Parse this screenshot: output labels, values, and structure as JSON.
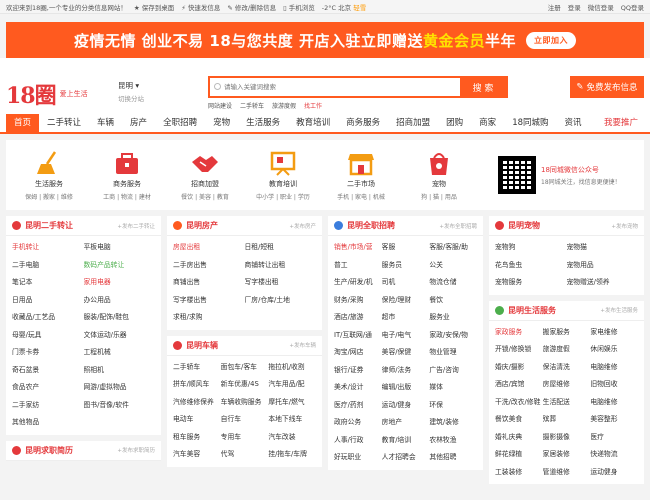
{
  "topbar": {
    "welcome": "欢迎来到18圈,一个专业的分类信息网站！",
    "links": [
      "保存到桌面",
      "快速发信息",
      "修改/删除信息",
      "手机浏览"
    ],
    "weather": "-2°C 北京",
    "weather_extra": "轻雪",
    "right": [
      "注册",
      "登录",
      "微信登录",
      "QQ登录"
    ]
  },
  "banner": {
    "text1": "疫情无情 创业不易 18与您共度 开店入驻立即赠送",
    "gold": "黄金会员",
    "text2": "半年",
    "button": "立即加入"
  },
  "header": {
    "logo_num": "18圈",
    "logo_tag": "爱上生活",
    "city": "昆明",
    "city_arrow": "·",
    "switch": "切换分站",
    "search_placeholder": "请输入关键词搜索",
    "search_button": "搜 索",
    "hot": [
      "网站建设",
      "二手轿车",
      "旅游度假",
      "找工作"
    ],
    "publish": "免费发布信息"
  },
  "nav": [
    "首页",
    "二手转让",
    "车辆",
    "房产",
    "全职招聘",
    "宠物",
    "生活服务",
    "教育培训",
    "商务服务",
    "招商加盟",
    "团购",
    "商家",
    "18同城购",
    "资讯",
    "我要推广"
  ],
  "categories": [
    {
      "name": "生活服务",
      "sub": "保姆 | 搬家 | 维修",
      "icon": "broom-icon"
    },
    {
      "name": "商务服务",
      "sub": "工商 | 物流 | 建材",
      "icon": "briefcase-icon"
    },
    {
      "name": "招商加盟",
      "sub": "餐饮 | 美容 | 教育",
      "icon": "handshake-icon"
    },
    {
      "name": "教育培训",
      "sub": "中小学 | 职业 | 学历",
      "icon": "blackboard-icon"
    },
    {
      "name": "二手市场",
      "sub": "手机 | 家电 | 机械",
      "icon": "shop-icon"
    },
    {
      "name": "宠物",
      "sub": "狗 | 猫 | 用品",
      "icon": "pet-bag-icon"
    }
  ],
  "qr": {
    "title": "18同城微信公众号",
    "desc": "18同城关注，找信息更便捷！"
  },
  "panels": {
    "used": {
      "title": "昆明二手转让",
      "link": "+发布二手转让",
      "items": [
        "手机转让",
        "平板电脑",
        "二手电脑",
        "数码产品转让",
        "笔记本",
        "家用电器",
        "日用品",
        "办公用品",
        "收藏品/工艺品",
        "服装/配饰/鞋包",
        "母婴/玩具",
        "文体运动/乐器",
        "门票卡券",
        "工程机械",
        "奇石盆景",
        "照相机",
        "食品农产",
        "网游/虚拟物品",
        "二手家纺",
        "图书/音像/软件",
        "其他物品",
        ""
      ]
    },
    "jobs2": {
      "title": "昆明求职简历",
      "link": "+发布求职简历"
    },
    "house": {
      "title": "昆明房产",
      "link": "+发布房产",
      "items": [
        "房屋出租",
        "日租/短租",
        "二手房出售",
        "商铺转让出租",
        "商铺出售",
        "写字楼出租",
        "写字楼出售",
        "厂房/仓库/土地",
        "求租/求购",
        ""
      ]
    },
    "cars": {
      "title": "昆明车辆",
      "link": "+发布车辆",
      "items": [
        "二手轿车",
        "面包车/客车",
        "拖拉机/收割",
        "拼车/顺风车",
        "新车优惠/4S",
        "汽车用品/配",
        "汽修维修保养",
        "车辆收购服务",
        "摩托车/燃气",
        "电动车",
        "自行车",
        "本地下线车",
        "租车服务",
        "专用车",
        "汽车改装",
        "汽车美容",
        "代驾",
        "挂/拖车/车牌"
      ]
    },
    "jobs": {
      "title": "昆明全职招聘",
      "link": "+发布全职招聘",
      "items": [
        "销售/市场/营",
        "客服",
        "客服/客服/助",
        "普工",
        "服务员",
        "公关",
        "生产/研发/机",
        "司机",
        "物流仓储",
        "财务/采购",
        "保险/理财",
        "餐饮",
        "酒店/旅游",
        "超市",
        "服务业",
        "IT/互联网/通",
        "电子/电气",
        "家政/安保/物",
        "淘宝/网店",
        "美容/保健",
        "物业管理",
        "银行/证券",
        "律师/法务",
        "广告/咨询",
        "美术/设计",
        "编辑/出版",
        "媒体",
        "医疗/药剂",
        "运动/健身",
        "环保",
        "政府公务",
        "房地产",
        "建筑/装修",
        "人事/行政",
        "教育/培训",
        "农林牧渔",
        "好玩职业",
        "人才招聘会",
        "其他招聘"
      ]
    },
    "pets": {
      "title": "昆明宠物",
      "link": "+发布宠物",
      "items": [
        "宠物狗",
        "宠物猫",
        "花鸟鱼虫",
        "宠物用品",
        "宠物服务",
        "宠物赠送/领养"
      ]
    },
    "life": {
      "title": "昆明生活服务",
      "link": "+发布生活服务",
      "items": [
        "家政服务",
        "搬家服务",
        "家电维修",
        "开锁/修换锁",
        "旅游度假",
        "休闲娱乐",
        "婚庆/摄影",
        "保洁清洗",
        "电脑维修",
        "酒店/宾馆",
        "房屋维修",
        "旧物回收",
        "干洗/改衣/修鞋",
        "生活配送",
        "电脑维修",
        "餐饮美食",
        "殡葬",
        "美容整形",
        "婚礼庆典",
        "摄影摄像",
        "医疗",
        "鲜花绿植",
        "家居装修",
        "快递物流",
        "工装装修",
        "管道维修",
        "运动健身"
      ]
    }
  },
  "colors": {
    "accent": "#ff5a1f",
    "red": "#e4393c"
  }
}
